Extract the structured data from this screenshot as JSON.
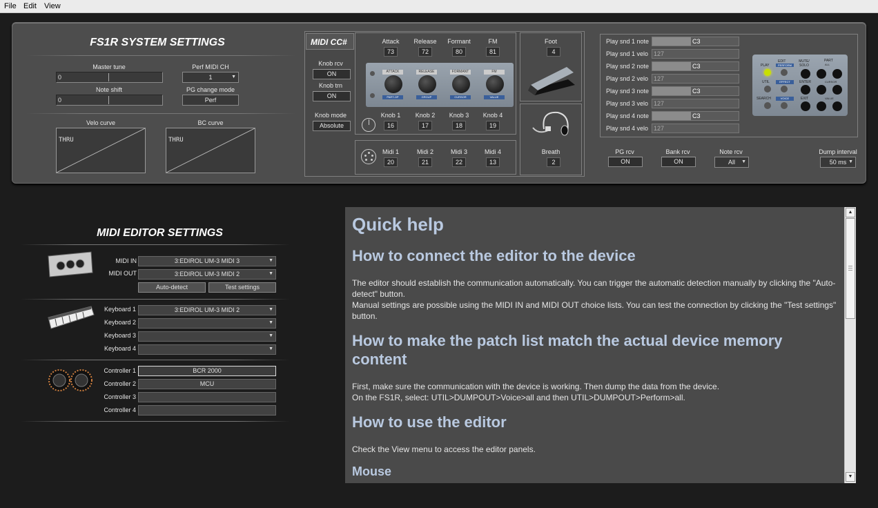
{
  "menu": [
    "File",
    "Edit",
    "View"
  ],
  "system": {
    "title": "FS1R SYSTEM SETTINGS",
    "master_tune": {
      "label": "Master tune",
      "value": "0"
    },
    "note_shift": {
      "label": "Note shift",
      "value": "0"
    },
    "perf_midi_ch": {
      "label": "Perf MIDI CH",
      "value": "1"
    },
    "pg_change_mode": {
      "label": "PG change mode",
      "value": "Perf"
    },
    "velo_curve": {
      "label": "Velo curve",
      "value": "THRU"
    },
    "bc_curve": {
      "label": "BC curve",
      "value": "THRU"
    }
  },
  "midicc": {
    "title": "MIDI CC#",
    "knob_rcv": {
      "label": "Knob rcv",
      "value": "ON"
    },
    "knob_trn": {
      "label": "Knob trn",
      "value": "ON"
    },
    "knob_mode": {
      "label": "Knob mode",
      "value": "Absolute"
    },
    "top": [
      {
        "label": "Attack",
        "value": "73"
      },
      {
        "label": "Release",
        "value": "72"
      },
      {
        "label": "Formant",
        "value": "80"
      },
      {
        "label": "FM",
        "value": "81"
      }
    ],
    "panel_labels": [
      "ATTACK",
      "RELEASE",
      "FORMANT",
      "FM"
    ],
    "panel_sub": [
      "PART-OP",
      "GROUP",
      "CURSOR",
      "VALUE"
    ],
    "knobs": [
      {
        "label": "Knob 1",
        "value": "16"
      },
      {
        "label": "Knob 2",
        "value": "17"
      },
      {
        "label": "Knob 3",
        "value": "18"
      },
      {
        "label": "Knob 4",
        "value": "19"
      }
    ],
    "midi": [
      {
        "label": "Midi 1",
        "value": "20"
      },
      {
        "label": "Midi 2",
        "value": "21"
      },
      {
        "label": "Midi 3",
        "value": "22"
      },
      {
        "label": "Midi 4",
        "value": "13"
      }
    ],
    "foot": {
      "label": "Foot",
      "value": "4"
    },
    "breath": {
      "label": "Breath",
      "value": "2"
    }
  },
  "play": {
    "rows": [
      {
        "label": "Play snd 1 note",
        "value": "C3",
        "type": "note",
        "fill": 0.45
      },
      {
        "label": "Play snd 1 velo",
        "value": "127",
        "type": "velo"
      },
      {
        "label": "Play snd 2 note",
        "value": "C3",
        "type": "note",
        "fill": 0.45
      },
      {
        "label": "Play snd 2 velo",
        "value": "127",
        "type": "velo"
      },
      {
        "label": "Play snd 3 note",
        "value": "C3",
        "type": "note",
        "fill": 0.45
      },
      {
        "label": "Play snd 3 velo",
        "value": "127",
        "type": "velo"
      },
      {
        "label": "Play snd 4 note",
        "value": "C3",
        "type": "note",
        "fill": 0.45
      },
      {
        "label": "Play snd 4 velo",
        "value": "127",
        "type": "velo"
      }
    ],
    "panel": {
      "play": "PLAY",
      "edit": "EDIT",
      "perform": "PERFORM",
      "mute_solo": "MUTE/ SOLO",
      "part": "PART",
      "all": "ALL",
      "util": "UTIL",
      "effect": "EFFECT",
      "enter": "ENTER",
      "cursor": "CURSOR",
      "search": "SEARCH",
      "voice": "VOICE",
      "exit": "EXIT",
      "value": "VALUE"
    }
  },
  "rcv": {
    "pg_rcv": {
      "label": "PG rcv",
      "value": "ON"
    },
    "bank_rcv": {
      "label": "Bank rcv",
      "value": "ON"
    },
    "note_rcv": {
      "label": "Note rcv",
      "value": "All"
    },
    "dump_interval": {
      "label": "Dump interval",
      "value": "50 ms"
    }
  },
  "editor": {
    "title": "MIDI EDITOR SETTINGS",
    "midi_in": {
      "label": "MIDI IN",
      "value": "3:EDIROL UM-3 MIDI 3"
    },
    "midi_out": {
      "label": "MIDI OUT",
      "value": "3:EDIROL UM-3 MIDI 2"
    },
    "auto_detect": "Auto-detect",
    "test_settings": "Test settings",
    "keyboards": [
      {
        "label": "Keyboard 1",
        "value": "3:EDIROL UM-3 MIDI 2"
      },
      {
        "label": "Keyboard 2",
        "value": ""
      },
      {
        "label": "Keyboard 3",
        "value": ""
      },
      {
        "label": "Keyboard 4",
        "value": ""
      }
    ],
    "controllers": [
      {
        "label": "Controller 1",
        "value": "BCR 2000"
      },
      {
        "label": "Controller 2",
        "value": "MCU"
      },
      {
        "label": "Controller 3",
        "value": ""
      },
      {
        "label": "Controller 4",
        "value": ""
      }
    ]
  },
  "help": {
    "title": "Quick help",
    "s1": "How to connect the editor to the device",
    "p1": "The editor should establish the communication automatically. You can trigger the automatic detection manually by clicking the \"Auto-detect\" button.",
    "p1b": "Manual settings are possible using the MIDI IN and MIDI OUT choice lists. You can test the connection by clicking the \"Test settings\" button.",
    "s2": "How to make the patch list match the actual device memory content",
    "p2": "First, make sure the communication with the device is working. Then dump the data from the device.",
    "p2b": "On the FS1R, select: UTIL>DUMPOUT>Voice>all and then UTIL>DUMPOUT>Perform>all.",
    "s3": "How to use the editor",
    "p3": "Check the View menu to access the editor panels.",
    "s4": "Mouse"
  }
}
